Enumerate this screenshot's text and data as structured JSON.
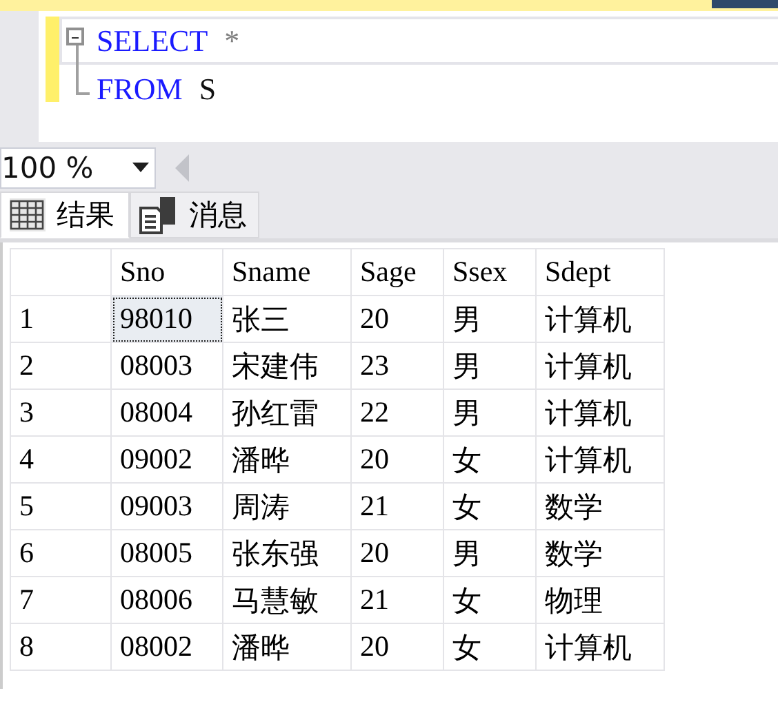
{
  "editor": {
    "lines": [
      {
        "tokens": [
          {
            "text": "SELECT",
            "kind": "keyword"
          },
          {
            "text": "*",
            "kind": "operator"
          }
        ],
        "current": true,
        "kind": "opener"
      },
      {
        "tokens": [
          {
            "text": "FROM",
            "kind": "keyword"
          },
          {
            "text": "S",
            "kind": "name"
          }
        ],
        "current": false,
        "kind": "closer"
      }
    ]
  },
  "zoom": {
    "value": "100 %"
  },
  "tabs": [
    {
      "label": "结果",
      "kind": "grid",
      "selected": true
    },
    {
      "label": "消息",
      "kind": "messages",
      "selected": false
    }
  ],
  "table": {
    "columns": [
      "Sno",
      "Sname",
      "Sage",
      "Ssex",
      "Sdept"
    ],
    "rows": [
      {
        "number": "1",
        "cells": [
          {
            "text": "98010",
            "selected": true
          },
          {
            "text": "张三",
            "selected": false
          },
          {
            "text": "20",
            "selected": false
          },
          {
            "text": "男",
            "selected": false
          },
          {
            "text": "计算机",
            "selected": false
          }
        ]
      },
      {
        "number": "2",
        "cells": [
          {
            "text": "08003",
            "selected": false
          },
          {
            "text": "宋建伟",
            "selected": false
          },
          {
            "text": "23",
            "selected": false
          },
          {
            "text": "男",
            "selected": false
          },
          {
            "text": "计算机",
            "selected": false
          }
        ]
      },
      {
        "number": "3",
        "cells": [
          {
            "text": "08004",
            "selected": false
          },
          {
            "text": "孙红雷",
            "selected": false
          },
          {
            "text": "22",
            "selected": false
          },
          {
            "text": "男",
            "selected": false
          },
          {
            "text": "计算机",
            "selected": false
          }
        ]
      },
      {
        "number": "4",
        "cells": [
          {
            "text": "09002",
            "selected": false
          },
          {
            "text": "潘晔",
            "selected": false
          },
          {
            "text": "20",
            "selected": false
          },
          {
            "text": "女",
            "selected": false
          },
          {
            "text": "计算机",
            "selected": false
          }
        ]
      },
      {
        "number": "5",
        "cells": [
          {
            "text": "09003",
            "selected": false
          },
          {
            "text": "周涛",
            "selected": false
          },
          {
            "text": "21",
            "selected": false
          },
          {
            "text": "女",
            "selected": false
          },
          {
            "text": "数学",
            "selected": false
          }
        ]
      },
      {
        "number": "6",
        "cells": [
          {
            "text": "08005",
            "selected": false
          },
          {
            "text": "张东强",
            "selected": false
          },
          {
            "text": "20",
            "selected": false
          },
          {
            "text": "男",
            "selected": false
          },
          {
            "text": "数学",
            "selected": false
          }
        ]
      },
      {
        "number": "7",
        "cells": [
          {
            "text": "08006",
            "selected": false
          },
          {
            "text": "马慧敏",
            "selected": false
          },
          {
            "text": "21",
            "selected": false
          },
          {
            "text": "女",
            "selected": false
          },
          {
            "text": "物理",
            "selected": false
          }
        ]
      },
      {
        "number": "8",
        "cells": [
          {
            "text": "08002",
            "selected": false
          },
          {
            "text": "潘晔",
            "selected": false
          },
          {
            "text": "20",
            "selected": false
          },
          {
            "text": "女",
            "selected": false
          },
          {
            "text": "计算机",
            "selected": false
          }
        ]
      }
    ]
  }
}
